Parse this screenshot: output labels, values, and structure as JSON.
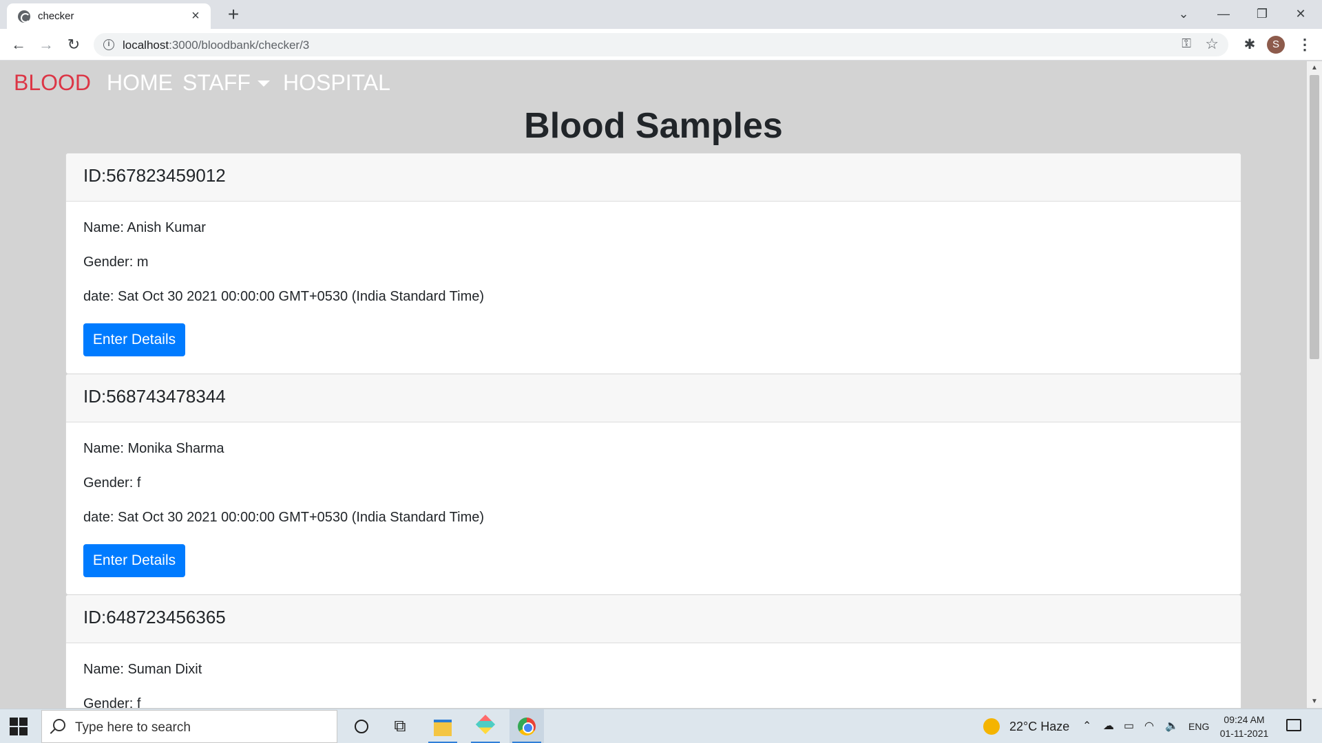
{
  "browser": {
    "tab_title": "checker",
    "url_host": "localhost",
    "url_path": ":3000/bloodbank/checker/3",
    "profile_initial": "S"
  },
  "nav": {
    "brand": "BLOOD",
    "links": [
      "HOME",
      "STAFF",
      "HOSPITAL"
    ]
  },
  "page": {
    "title": "Blood Samples",
    "samples": [
      {
        "id": "ID:567823459012",
        "name": "Name: Anish Kumar",
        "gender": "Gender: m",
        "date": "date: Sat Oct 30 2021 00:00:00 GMT+0530 (India Standard Time)",
        "button": "Enter Details"
      },
      {
        "id": "ID:568743478344",
        "name": "Name: Monika Sharma",
        "gender": "Gender: f",
        "date": "date: Sat Oct 30 2021 00:00:00 GMT+0530 (India Standard Time)",
        "button": "Enter Details"
      },
      {
        "id": "ID:648723456365",
        "name": "Name: Suman Dixit",
        "gender": "Gender: f"
      }
    ]
  },
  "taskbar": {
    "search_placeholder": "Type here to search",
    "weather": "22°C  Haze",
    "language": "ENG",
    "time": "09:24 AM",
    "date": "01-11-2021"
  },
  "colors": {
    "brand_red": "#dc3545",
    "button_blue": "#007bff",
    "page_bg": "#d3d3d3"
  }
}
